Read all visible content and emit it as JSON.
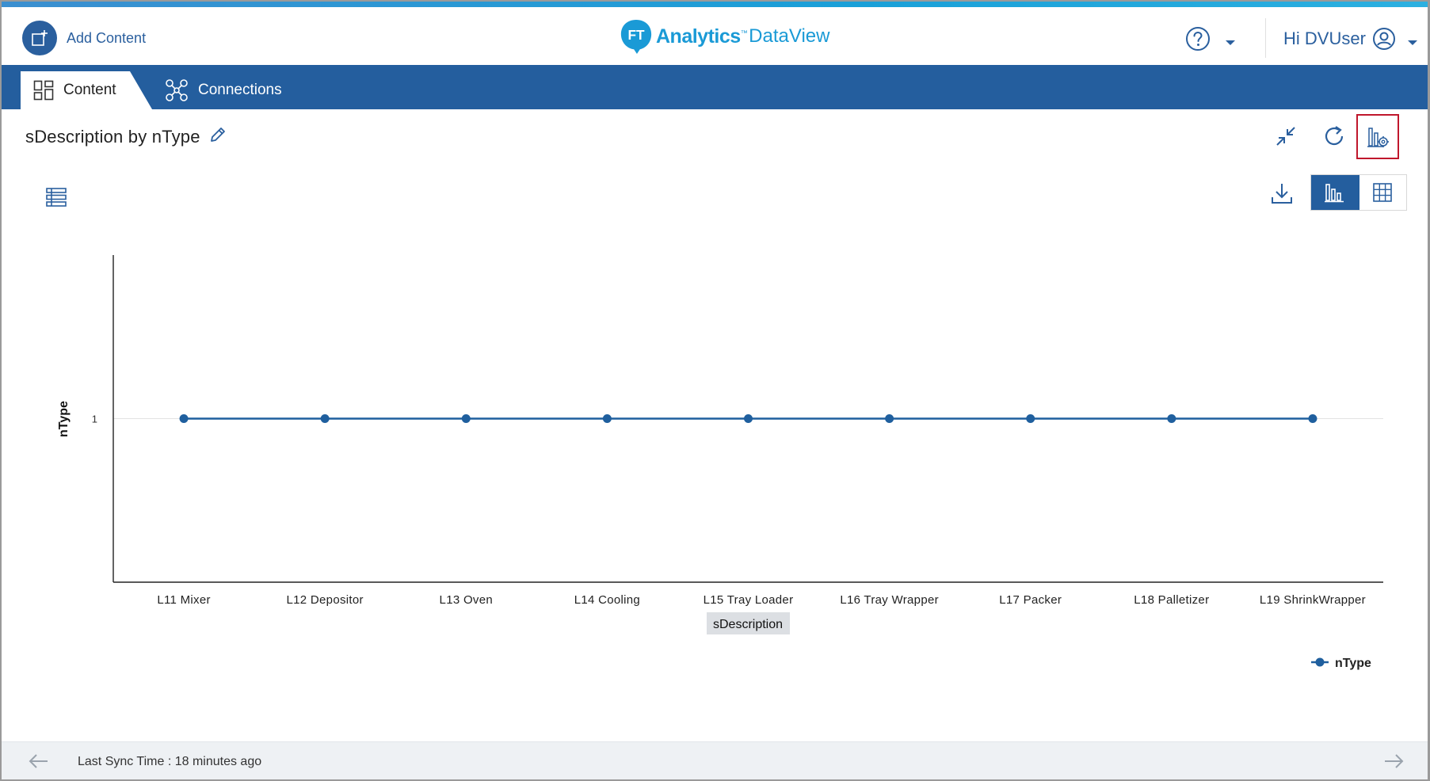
{
  "header": {
    "add_content_label": "Add Content",
    "logo_mark": "FT",
    "logo_brand": "Analytics",
    "logo_tm": "™",
    "logo_product": "DataView",
    "user_greeting": "Hi DVUser"
  },
  "tabs": [
    {
      "label": "Content",
      "active": true
    },
    {
      "label": "Connections",
      "active": false
    }
  ],
  "content": {
    "title": "sDescription by nType"
  },
  "chart_data": {
    "type": "line",
    "categories": [
      "L11 Mixer",
      "L12 Depositor",
      "L13 Oven",
      "L14 Cooling",
      "L15 Tray Loader",
      "L16 Tray Wrapper",
      "L17 Packer",
      "L18 Palletizer",
      "L19 ShrinkWrapper"
    ],
    "series": [
      {
        "name": "nType",
        "values": [
          1,
          1,
          1,
          1,
          1,
          1,
          1,
          1,
          1
        ],
        "color": "#1f5f9e"
      }
    ],
    "yticks": [
      1
    ],
    "ylim": [
      0,
      2
    ],
    "xlabel": "sDescription",
    "ylabel": "nType",
    "grid": true,
    "legend_position": "bottom-right"
  },
  "footer": {
    "sync_text": "Last Sync Time : 18 minutes ago"
  },
  "colors": {
    "primary": "#245e9e",
    "brand": "#1a9ad6",
    "highlight": "#c0172c"
  }
}
